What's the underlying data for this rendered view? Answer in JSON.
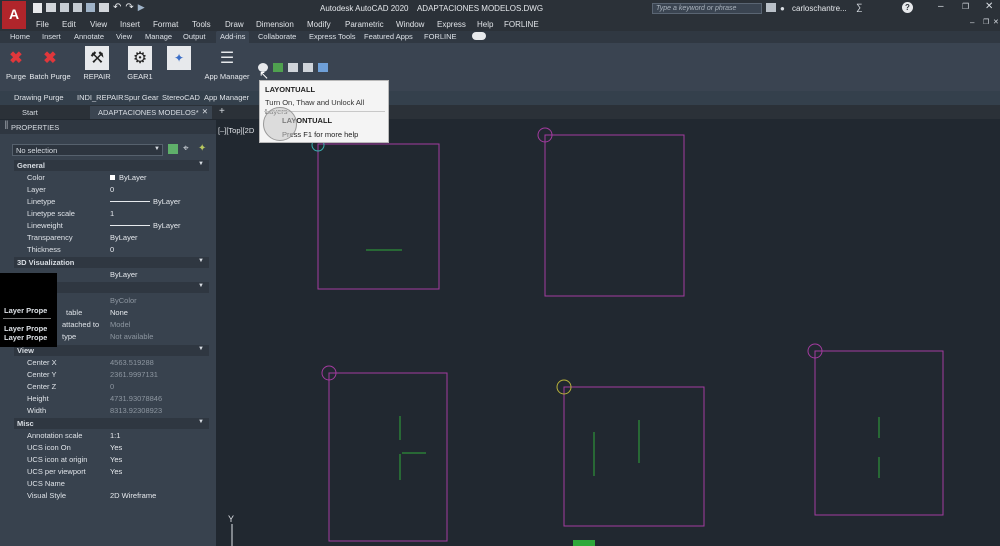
{
  "app": {
    "title": "Autodesk AutoCAD 2020",
    "file": "ADAPTACIONES MODELOS.DWG",
    "search_placeholder": "Type a keyword or phrase",
    "user": "carloschantre..."
  },
  "menubar": [
    "File",
    "Edit",
    "View",
    "Insert",
    "Format",
    "Tools",
    "Draw",
    "Dimension",
    "Modify",
    "Parametric",
    "Window",
    "Express",
    "Help",
    "FORLINE"
  ],
  "ribbon_tabs": [
    "Home",
    "Insert",
    "Annotate",
    "View",
    "Manage",
    "Output",
    "Add-ins",
    "Collaborate",
    "Express Tools",
    "Featured Apps",
    "FORLINE"
  ],
  "ribbon_buttons": [
    "Purge",
    "Batch Purge",
    "REPAIR",
    "GEAR1",
    "App Manager"
  ],
  "ribbon_panels": [
    "Drawing Purge",
    "INDI_REPAIR",
    "Spur Gear",
    "StereoCAD",
    "App Manager"
  ],
  "doc_tabs": {
    "start": "Start",
    "active": "ADAPTACIONES MODELOS*",
    "add": "+"
  },
  "tooltip": {
    "command": "LAYONTUALL",
    "description": "Turn On, Thaw and Unlock All Layers",
    "command2": "LAYONTUALL",
    "help": "Press F1 for more help"
  },
  "properties": {
    "title": "PROPERTIES",
    "selection": "No selection",
    "general": {
      "title": "General",
      "rows": [
        {
          "k": "Color",
          "v": "ByLayer"
        },
        {
          "k": "Layer",
          "v": "0"
        },
        {
          "k": "Linetype",
          "v": "ByLayer"
        },
        {
          "k": "Linetype scale",
          "v": "1"
        },
        {
          "k": "Lineweight",
          "v": "ByLayer"
        },
        {
          "k": "Transparency",
          "v": "ByLayer"
        },
        {
          "k": "Thickness",
          "v": "0"
        }
      ]
    },
    "viz3d": {
      "title": "3D Visualization",
      "material_value": "ByLayer"
    },
    "plot": {
      "rows": [
        {
          "k": "",
          "v": "ByColor"
        },
        {
          "k": "table",
          "v": "None"
        },
        {
          "k": "attached to",
          "v": "Model"
        },
        {
          "k": "type",
          "v": "Not available"
        }
      ]
    },
    "view": {
      "title": "View",
      "rows": [
        {
          "k": "Center X",
          "v": "4563.519288"
        },
        {
          "k": "Center Y",
          "v": "2361.9997131"
        },
        {
          "k": "Center Z",
          "v": "0"
        },
        {
          "k": "Height",
          "v": "4731.93078846"
        },
        {
          "k": "Width",
          "v": "8313.92308923"
        }
      ]
    },
    "misc": {
      "title": "Misc",
      "rows": [
        {
          "k": "Annotation scale",
          "v": "1:1"
        },
        {
          "k": "UCS icon On",
          "v": "Yes"
        },
        {
          "k": "UCS icon at origin",
          "v": "Yes"
        },
        {
          "k": "UCS per viewport",
          "v": "Yes"
        },
        {
          "k": "UCS Name",
          "v": ""
        },
        {
          "k": "Visual Style",
          "v": "2D Wireframe"
        }
      ]
    }
  },
  "layer_popup": [
    "Layer Prope",
    "Layer Prope",
    "Layer Prope"
  ],
  "viewport_label": "[–][Top][2D",
  "ucs_y": "Y",
  "colors": {
    "magenta": "#a43ba0",
    "green": "#2fa83a",
    "yellow": "#b8b23a"
  }
}
